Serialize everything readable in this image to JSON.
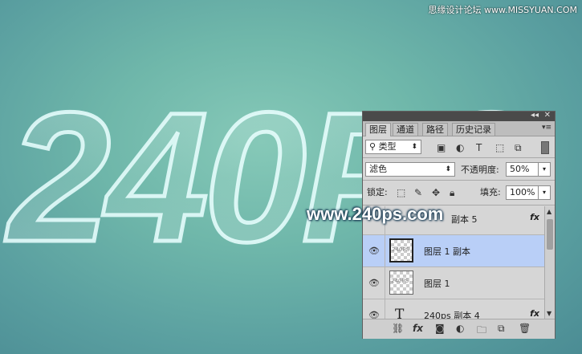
{
  "site_credit": "思缘设计论坛 www.MISSYUAN.COM",
  "artwork_text": "240PS",
  "watermark": "www.240ps.com",
  "panel": {
    "tabs": [
      "图层",
      "通道",
      "路径",
      "历史记录"
    ],
    "filter_kind": "类型",
    "blend_mode": "滤色",
    "opacity_label": "不透明度:",
    "opacity_value": "50%",
    "lock_label": "锁定:",
    "fill_label": "填充:",
    "fill_value": "100%",
    "layers": [
      {
        "name": "副本 5",
        "fx": "fx"
      },
      {
        "name": "图层 1 副本"
      },
      {
        "name": "图层 1"
      },
      {
        "name": "240ps 副本 4",
        "fx": "fx"
      }
    ],
    "thumb_text": "240PS"
  },
  "colors": {
    "selected_layer": "#b9cff7",
    "panel_bg": "#d6d6d6"
  }
}
